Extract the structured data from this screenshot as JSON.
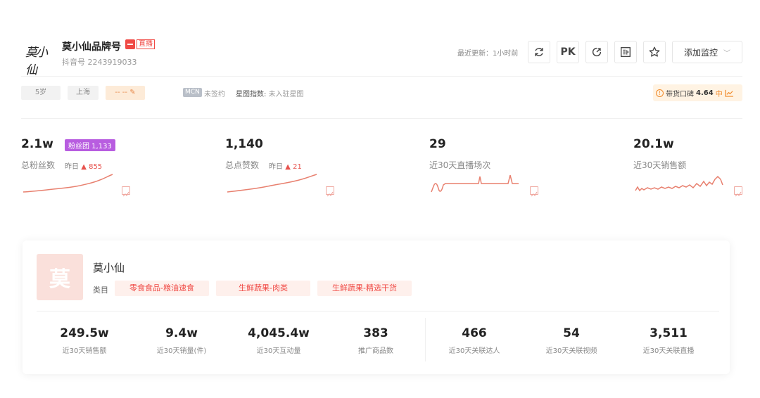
{
  "profile": {
    "logo_text": "莫小仙",
    "brand_name": "莫小仙品牌号",
    "live_badge": "直播",
    "douyin_id": "抖音号 2243919033"
  },
  "toolbar": {
    "last_update": "最近更新：1小时前",
    "pk_label": "PK",
    "add_monitor_label": "添加监控"
  },
  "tags": {
    "age": "5岁",
    "location": "上海",
    "edit_placeholder": "-- --",
    "mcn_badge": "MCN",
    "mcn_status": "未签约",
    "star_index_label": "星图指数:",
    "star_index_value": "未入驻星图",
    "reputation_label": "带货口碑",
    "reputation_value": "4.64",
    "reputation_level": "中"
  },
  "stats": [
    {
      "value": "2.1w",
      "label": "总粉丝数",
      "yday_label": "昨日",
      "yday_change": "855",
      "badge": "粉丝团 1,133"
    },
    {
      "value": "1,140",
      "label": "总点赞数",
      "yday_label": "昨日",
      "yday_change": "21"
    },
    {
      "value": "29",
      "label": "近30天直播场次"
    },
    {
      "value": "20.1w",
      "label": "近30天销售额"
    }
  ],
  "brand_card": {
    "avatar_char": "莫",
    "name": "莫小仙",
    "category_label": "类目",
    "categories": [
      "零食食品-粮油速食",
      "生鲜蔬果-肉类",
      "生鲜蔬果-精选干货"
    ],
    "metrics": [
      {
        "value": "249.5w",
        "label": "近30天销售额"
      },
      {
        "value": "9.4w",
        "label": "近30天销量(件)"
      },
      {
        "value": "4,045.4w",
        "label": "近30天互动量"
      },
      {
        "value": "383",
        "label": "推广商品数"
      },
      {
        "value": "466",
        "label": "近30天关联达人"
      },
      {
        "value": "54",
        "label": "近30天关联视频"
      },
      {
        "value": "3,511",
        "label": "近30天关联直播"
      }
    ]
  },
  "colors": {
    "accent_red": "#f04a45",
    "spark_line": "#e8806f",
    "fans_badge": "#b85de0",
    "warm_tag": "#fdebd8"
  }
}
